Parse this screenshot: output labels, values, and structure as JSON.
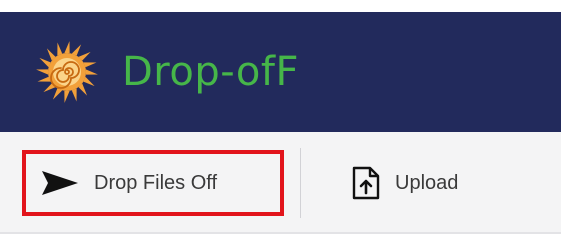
{
  "app": {
    "title": "Drop-ofF",
    "logo_icon": "sun-spiral-icon",
    "header_color": "#222a5c",
    "title_color": "#46b649",
    "logo_color": "#f2a03a"
  },
  "toolbar": {
    "drop_label": "Drop Files Off",
    "drop_icon": "send-arrow-icon",
    "upload_label": "Upload",
    "upload_icon": "file-upload-icon",
    "highlight_color": "#e2141b"
  }
}
